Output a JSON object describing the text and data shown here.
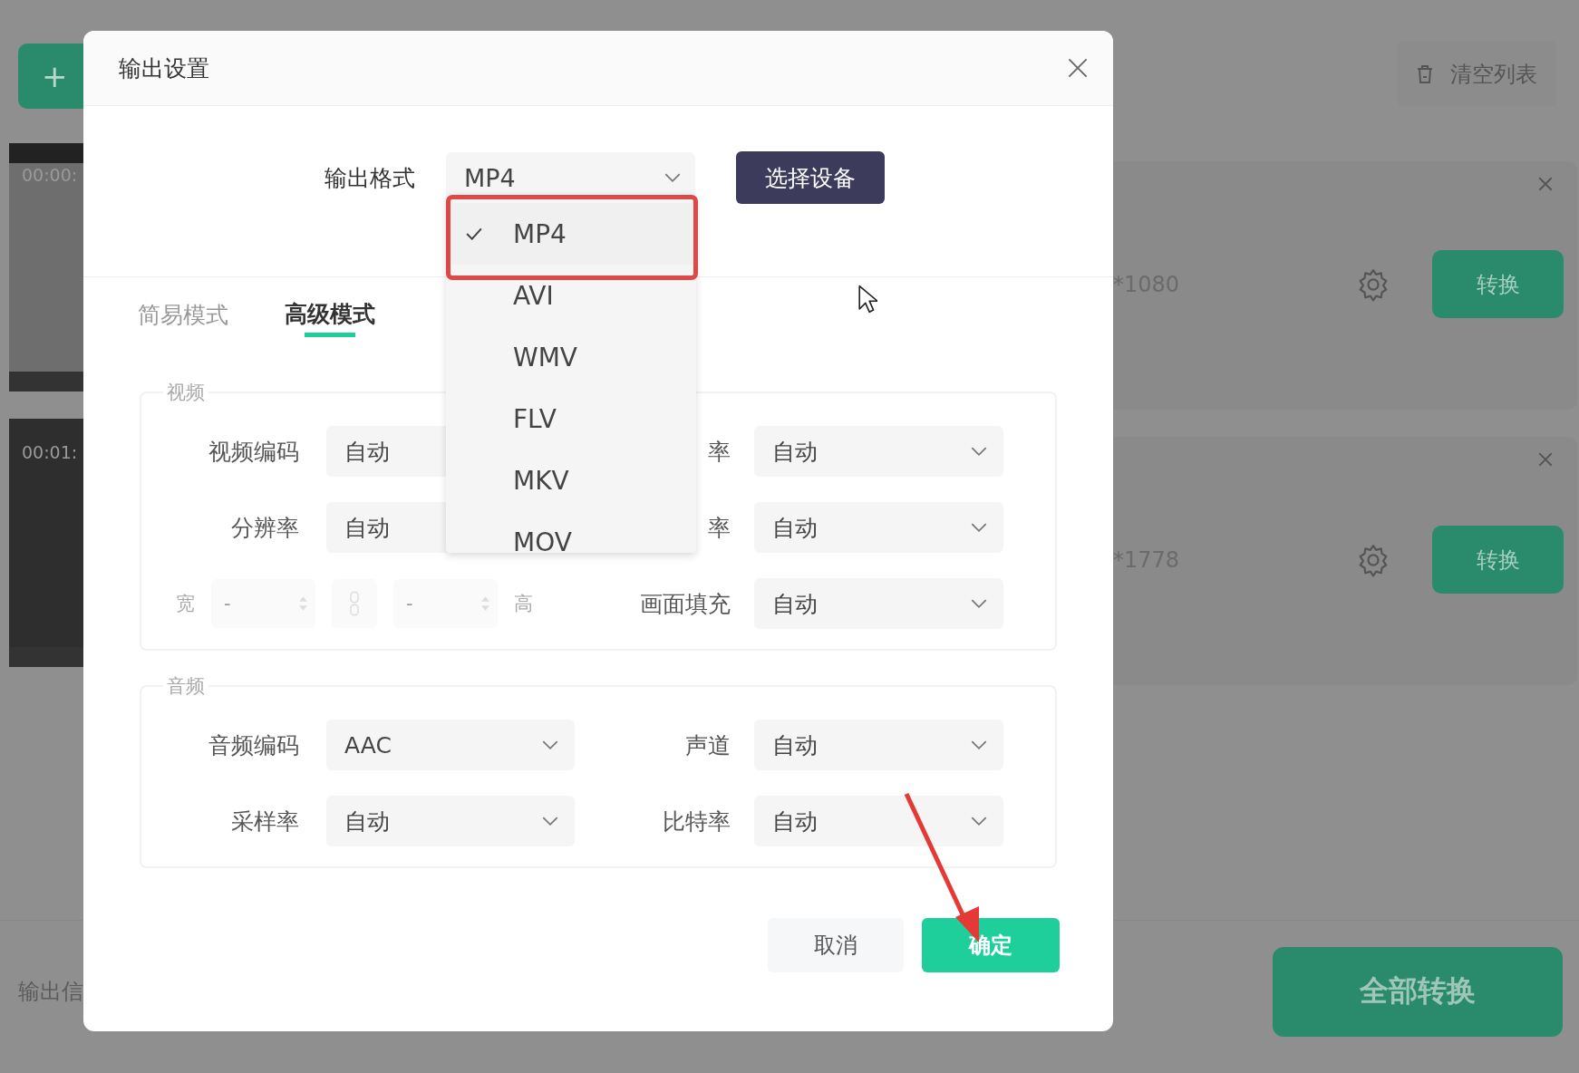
{
  "background": {
    "add_button": {
      "label": "+"
    },
    "clips": [
      {
        "time": "00:00:"
      },
      {
        "time": "00:01:"
      }
    ],
    "files": [
      {
        "resolution": "*1080",
        "action": "转换"
      },
      {
        "resolution": "*1778",
        "action": "转换"
      }
    ],
    "clear_button": "清空列表",
    "output_label": "输出信",
    "convert_all": "全部转换"
  },
  "dialog": {
    "title": "输出设置",
    "format": {
      "label": "输出格式",
      "value": "MP4",
      "options": [
        {
          "label": "MP4",
          "selected": true
        },
        {
          "label": "AVI",
          "selected": false
        },
        {
          "label": "WMV",
          "selected": false
        },
        {
          "label": "FLV",
          "selected": false
        },
        {
          "label": "MKV",
          "selected": false
        },
        {
          "label": "MOV",
          "selected": false
        }
      ],
      "device_button": "选择设备"
    },
    "tabs": [
      {
        "label": "简易模式",
        "selected": false
      },
      {
        "label": "高级模式",
        "selected": true
      }
    ],
    "sections": [
      {
        "legend": "视频",
        "items": [
          {
            "kind": "covered",
            "label": "视频编码",
            "value": "自动"
          },
          {
            "kind": "select",
            "label": "率",
            "value": "自动"
          },
          {
            "kind": "covered",
            "label": "分辨率",
            "value": "自动"
          },
          {
            "kind": "select",
            "label": "率",
            "value": "自动"
          },
          {
            "kind": "size",
            "width_label": "宽",
            "width_value": "-",
            "height_label": "高",
            "height_value": "-"
          },
          {
            "kind": "select",
            "label": "画面填充",
            "value": "自动"
          }
        ]
      },
      {
        "legend": "音频",
        "items": [
          {
            "kind": "select",
            "label": "音频编码",
            "value": "AAC"
          },
          {
            "kind": "select",
            "label": "声道",
            "value": "自动"
          },
          {
            "kind": "select",
            "label": "采样率",
            "value": "自动"
          },
          {
            "kind": "select",
            "label": "比特率",
            "value": "自动"
          }
        ]
      }
    ],
    "cancel_button": "取消",
    "ok_button": "确定"
  }
}
